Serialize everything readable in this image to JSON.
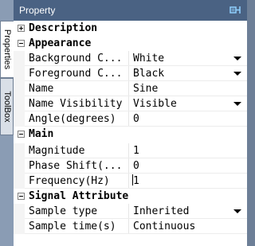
{
  "panel": {
    "title": "Property"
  },
  "side_tabs": [
    {
      "label": "Properties"
    },
    {
      "label": "ToolBox"
    }
  ],
  "grid": {
    "categories": {
      "description": {
        "label": "Description",
        "toggle": "+"
      },
      "appearance": {
        "label": "Appearance",
        "toggle": "-"
      },
      "main": {
        "label": "Main",
        "toggle": "-"
      },
      "signal": {
        "label": "Signal Attribute",
        "toggle": "-"
      }
    },
    "appearance": [
      {
        "name": "Background C...",
        "value": "White",
        "dropdown": true
      },
      {
        "name": "Foreground C...",
        "value": "Black",
        "dropdown": true
      },
      {
        "name": "Name",
        "value": "Sine",
        "dropdown": false
      },
      {
        "name": "Name Visibility",
        "value": "Visible",
        "dropdown": true
      },
      {
        "name": "Angle(degrees)",
        "value": "0",
        "dropdown": false
      }
    ],
    "main": [
      {
        "name": "Magnitude",
        "value": "1",
        "dropdown": false
      },
      {
        "name": "Phase Shift(...",
        "value": "0",
        "dropdown": false
      },
      {
        "name": "Frequency(Hz)",
        "value": "1",
        "dropdown": false
      }
    ],
    "signal": [
      {
        "name": "Sample type",
        "value": "Inherited",
        "dropdown": true
      },
      {
        "name": "Sample time(s)",
        "value": "Continuous",
        "dropdown": false
      }
    ]
  },
  "colors": {
    "titlebar": "#4a6283",
    "frame": "#8a9cb4",
    "grid_background": "#ffffff"
  }
}
